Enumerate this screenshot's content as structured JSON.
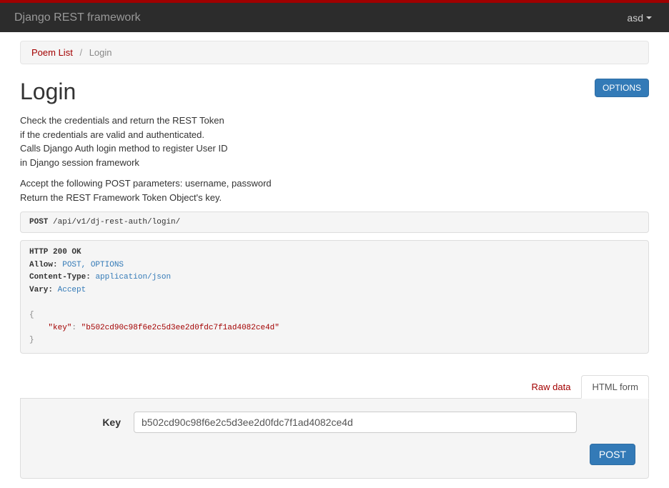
{
  "navbar": {
    "brand": "Django REST framework",
    "user": "asd"
  },
  "breadcrumb": {
    "root": "Poem List",
    "current": "Login"
  },
  "page": {
    "title": "Login",
    "options_label": "OPTIONS"
  },
  "description": {
    "p1": "Check the credentials and return the REST Token\nif the credentials are valid and authenticated.\nCalls Django Auth login method to register User ID\nin Django session framework",
    "p2": "Accept the following POST parameters: username, password\nReturn the REST Framework Token Object's key."
  },
  "request": {
    "method": "POST",
    "path": "/api/v1/dj-rest-auth/login/"
  },
  "response": {
    "status": "HTTP 200 OK",
    "headers": {
      "allow_name": "Allow:",
      "allow_val": "POST, OPTIONS",
      "ct_name": "Content-Type:",
      "ct_val": "application/json",
      "vary_name": "Vary:",
      "vary_val": "Accept"
    },
    "body": {
      "key_name": "\"key\"",
      "key_val": "\"b502cd90c98f6e2c5d3ee2d0fdc7f1ad4082ce4d\""
    }
  },
  "tabs": {
    "raw": "Raw data",
    "html": "HTML form"
  },
  "form": {
    "key_label": "Key",
    "key_value": "b502cd90c98f6e2c5d3ee2d0fdc7f1ad4082ce4d",
    "submit": "POST"
  }
}
